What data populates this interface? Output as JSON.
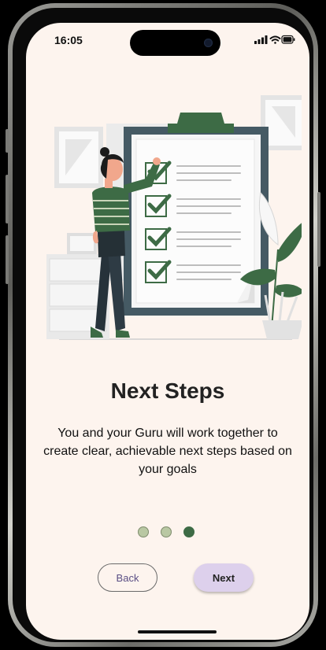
{
  "status_bar": {
    "time": "16:05",
    "icons": [
      "signal-icon",
      "wifi-icon",
      "battery-icon"
    ]
  },
  "onboarding": {
    "title": "Next Steps",
    "description": "You and your Guru will work together to create clear, achievable next steps based on your goals",
    "page_indicator": {
      "total": 3,
      "current": 3
    },
    "back_label": "Back",
    "next_label": "Next"
  },
  "colors": {
    "background": "#fdf4ee",
    "accent_green": "#3d6b45",
    "inactive_dot": "#b9c8a3",
    "next_button": "#ddd0ec",
    "back_text": "#5a4e84"
  }
}
